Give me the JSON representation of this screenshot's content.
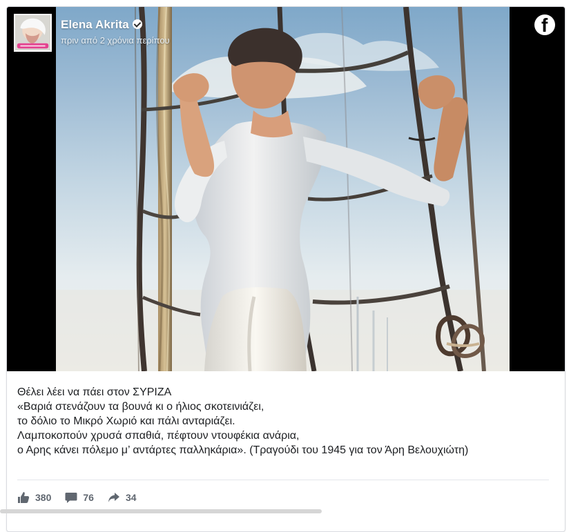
{
  "post": {
    "author": "Elena Akrita",
    "time": "πριν από 2 χρόνια περίπου",
    "caption_lines": [
      "Θέλει λέει να πάει στον ΣΥΡΙΖΑ",
      "«Βαριά στενάζουν τα βουνά κι ο ήλιος σκοτεινιάζει,",
      "το δόλιο το Μικρό Χωριό και πάλι ανταριάζει.",
      "Λαμποκοπούν χρυσά σπαθιά, πέφτουν ντουφέκια ανάρια,",
      "ο Αρης κάνει πόλεμο μ’ αντάρτες παλληκάρια». (Τραγούδι του 1945 για τον Άρη Βελουχιώτη)"
    ],
    "reactions": {
      "likes": "380",
      "comments": "76",
      "shares": "34"
    }
  },
  "icons": {
    "verified": "verified-icon",
    "facebook": "facebook-icon",
    "like": "like-icon",
    "comment": "comment-icon",
    "share": "share-icon"
  },
  "colors": {
    "text": "#1c1e21",
    "muted": "#606770",
    "border": "#d9dbe0",
    "sky": "#9dbbd4"
  }
}
